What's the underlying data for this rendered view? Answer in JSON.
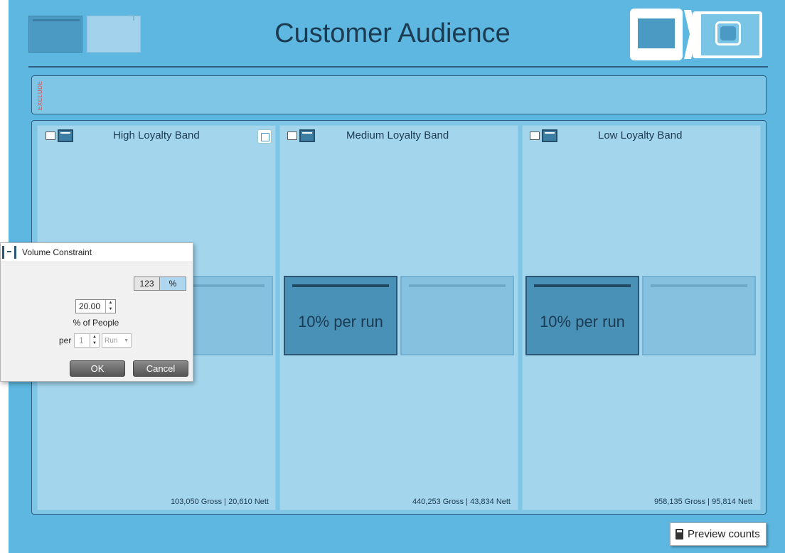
{
  "header": {
    "title": "Customer Audience"
  },
  "exclude": {
    "label": "EXCLUDE"
  },
  "bands": [
    {
      "title": "High Loyalty Band",
      "gross": "103,050",
      "gross_label": "Gross",
      "nett": "20,610",
      "nett_label": "Nett"
    },
    {
      "title": "Medium Loyalty Band",
      "gross": "440,253",
      "gross_label": "Gross",
      "nett": "43,834",
      "nett_label": "Nett",
      "constraint": "10% per run"
    },
    {
      "title": "Low Loyalty Band",
      "gross": "958,135",
      "gross_label": "Gross",
      "nett": "95,814",
      "nett_label": "Nett",
      "constraint": "10% per run"
    }
  ],
  "dialog": {
    "title": "Volume Constraint",
    "mode_options": [
      "123",
      "%"
    ],
    "selected_mode": "%",
    "value": "20.00",
    "unit_label": "% of  People",
    "per_label": "per",
    "per_value": "1",
    "per_unit": "Run",
    "ok_label": "OK",
    "cancel_label": "Cancel"
  },
  "footer": {
    "preview_label": "Preview counts"
  },
  "colors": {
    "background": "#5db7e0",
    "band": "#a3d6ed",
    "constraint_active": "#4a91b8",
    "exclude_text": "#e64a4a"
  }
}
